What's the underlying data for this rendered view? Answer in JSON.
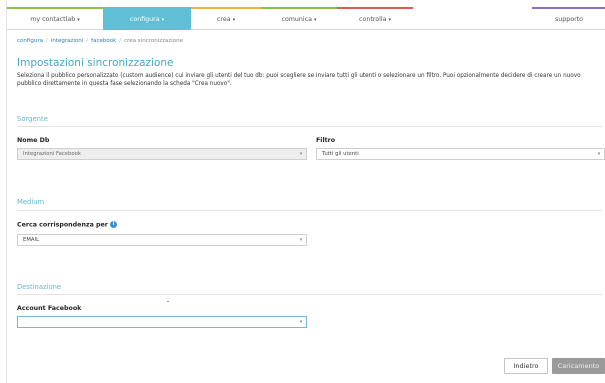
{
  "nav": {
    "items": [
      {
        "label": "my contactlab",
        "caret": "▾",
        "stripe": "#8fc24a"
      },
      {
        "label": "configura",
        "caret": "▾",
        "stripe": "#5fbfd4"
      },
      {
        "label": "crea",
        "caret": "▾",
        "stripe": "#f0b43c"
      },
      {
        "label": "comunica",
        "caret": "▾",
        "stripe": "#86c04e"
      },
      {
        "label": "controlla",
        "caret": "▾",
        "stripe": "#e05a4f"
      },
      {
        "label": "supporto",
        "caret": "",
        "stripe": "#8e6fbf"
      }
    ],
    "active_index": 1
  },
  "breadcrumb": {
    "items": [
      "configura",
      "integrazioni",
      "facebook",
      "crea sincronizzazione"
    ],
    "separator": "/"
  },
  "page": {
    "title": "Impostazioni sincronizzazione",
    "description": "Seleziona il pubblico personalizzato (custom audience) cui inviare gli utenti del tuo db: puoi scegliere se inviare tutti gli utenti o selezionare un filtro. Puoi opzionalmente decidere di creare un nuovo pubblico direttamente in questa fase selezionando la scheda \"Crea nuovo\"."
  },
  "sorgente": {
    "title": "Sorgente",
    "nome_db_label": "Nome Db",
    "nome_db_value": "Integrazioni Facebook",
    "filtro_label": "Filtro",
    "filtro_value": "Tutti gli utenti"
  },
  "medium": {
    "title": "Medium",
    "cerca_label": "Cerca corrispondenza per",
    "info_icon": "i",
    "cerca_value": "EMAIL"
  },
  "destinazione": {
    "title": "Destinazione",
    "account_label": "Account Facebook",
    "account_value": ""
  },
  "buttons": {
    "back": "Indietro",
    "load": "Caricamento"
  },
  "icons": {
    "select_arrow": "▾"
  },
  "colors": {
    "accent": "#5fbfd4",
    "title": "#46a9c6",
    "link": "#2a7fb5",
    "info": "#3a8ed4",
    "disabled_button": "#9a9a9a"
  }
}
